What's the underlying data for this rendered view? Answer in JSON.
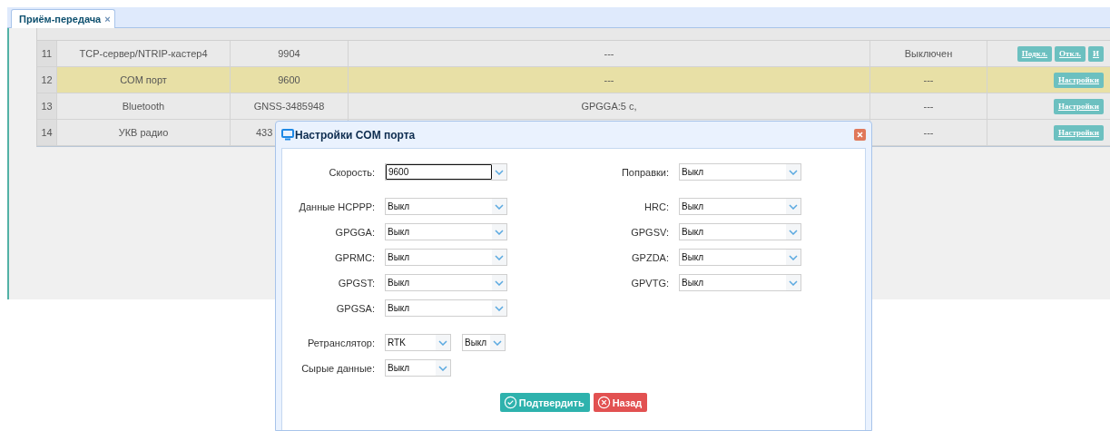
{
  "tabs": [
    {
      "label": "Приём-передача",
      "close": "×",
      "selected": true
    }
  ],
  "table": {
    "rows": [
      {
        "selected": false,
        "cells": [
          "11",
          "TCP-сервер/NTRIP-кастер4",
          "9904",
          "---",
          "Выключен"
        ],
        "actions": [
          "Подкл.",
          "Откл.",
          "И"
        ]
      },
      {
        "selected": true,
        "cells": [
          "12",
          "COM порт",
          "9600",
          "---",
          "---"
        ],
        "actions": [
          "Настройки"
        ]
      },
      {
        "selected": false,
        "cells": [
          "13",
          "Bluetooth",
          "GNSS-3485948",
          "GPGGA:5 с,",
          "---"
        ],
        "actions": [
          "Настройки"
        ]
      },
      {
        "selected": false,
        "cells": [
          "14",
          "УКВ радио",
          "433",
          "",
          "---"
        ],
        "actions": [
          "Настройки"
        ]
      }
    ]
  },
  "dialog": {
    "title": "Настройки COM порта",
    "sections": [
      {
        "rows": [
          {
            "fields": [
              {
                "label": "Скорость:",
                "controls": [
                  {
                    "kind": "combo",
                    "value": "9600"
                  }
                ]
              },
              {
                "label": "Поправки:",
                "controls": [
                  {
                    "kind": "select",
                    "value": "Выкл"
                  }
                ]
              }
            ]
          }
        ]
      },
      {
        "rows": [
          {
            "fields": [
              {
                "label": "Данные НСРРР:",
                "controls": [
                  {
                    "kind": "select",
                    "value": "Выкл"
                  }
                ]
              },
              {
                "label": "HRC:",
                "controls": [
                  {
                    "kind": "select",
                    "value": "Выкл"
                  }
                ]
              }
            ]
          },
          {
            "fields": [
              {
                "label": "GPGGA:",
                "controls": [
                  {
                    "kind": "select",
                    "value": "Выкл"
                  }
                ]
              },
              {
                "label": "GPGSV:",
                "controls": [
                  {
                    "kind": "select",
                    "value": "Выкл"
                  }
                ]
              }
            ]
          },
          {
            "fields": [
              {
                "label": "GPRMC:",
                "controls": [
                  {
                    "kind": "select",
                    "value": "Выкл"
                  }
                ]
              },
              {
                "label": "GPZDA:",
                "controls": [
                  {
                    "kind": "select",
                    "value": "Выкл"
                  }
                ]
              }
            ]
          },
          {
            "fields": [
              {
                "label": "GPGST:",
                "controls": [
                  {
                    "kind": "select",
                    "value": "Выкл"
                  }
                ]
              },
              {
                "label": "GPVTG:",
                "controls": [
                  {
                    "kind": "select",
                    "value": "Выкл"
                  }
                ]
              }
            ]
          },
          {
            "fields": [
              {
                "label": "GPGSA:",
                "controls": [
                  {
                    "kind": "select",
                    "value": "Выкл"
                  }
                ]
              }
            ]
          }
        ]
      },
      {
        "rows": [
          {
            "fields": [
              {
                "label": "Ретранслятор:",
                "controls": [
                  {
                    "kind": "short",
                    "value": "RTK"
                  },
                  {
                    "kind": "tiny",
                    "value": "Выкл"
                  }
                ]
              }
            ]
          },
          {
            "fields": [
              {
                "label": "Сырые данные:",
                "controls": [
                  {
                    "kind": "short",
                    "value": "Выкл"
                  }
                ]
              }
            ]
          }
        ]
      }
    ],
    "buttons": [
      {
        "kind": "confirm",
        "label": "Подтвердить"
      },
      {
        "kind": "back",
        "label": "Назад"
      }
    ]
  }
}
